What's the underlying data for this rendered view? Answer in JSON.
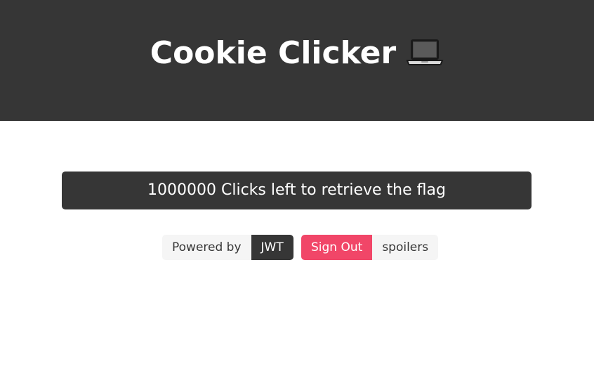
{
  "header": {
    "title": "Cookie Clicker",
    "icon": "laptop-icon"
  },
  "main": {
    "click_button_label": "1000000 Clicks left to retrieve the flag"
  },
  "tags": {
    "powered_by_label": "Powered by",
    "powered_by_value": "JWT",
    "sign_out_label": "Sign Out",
    "spoilers_label": "spoilers"
  },
  "colors": {
    "dark": "#363636",
    "danger": "#f14668",
    "light": "#f5f5f5",
    "background": "#ffffff"
  }
}
